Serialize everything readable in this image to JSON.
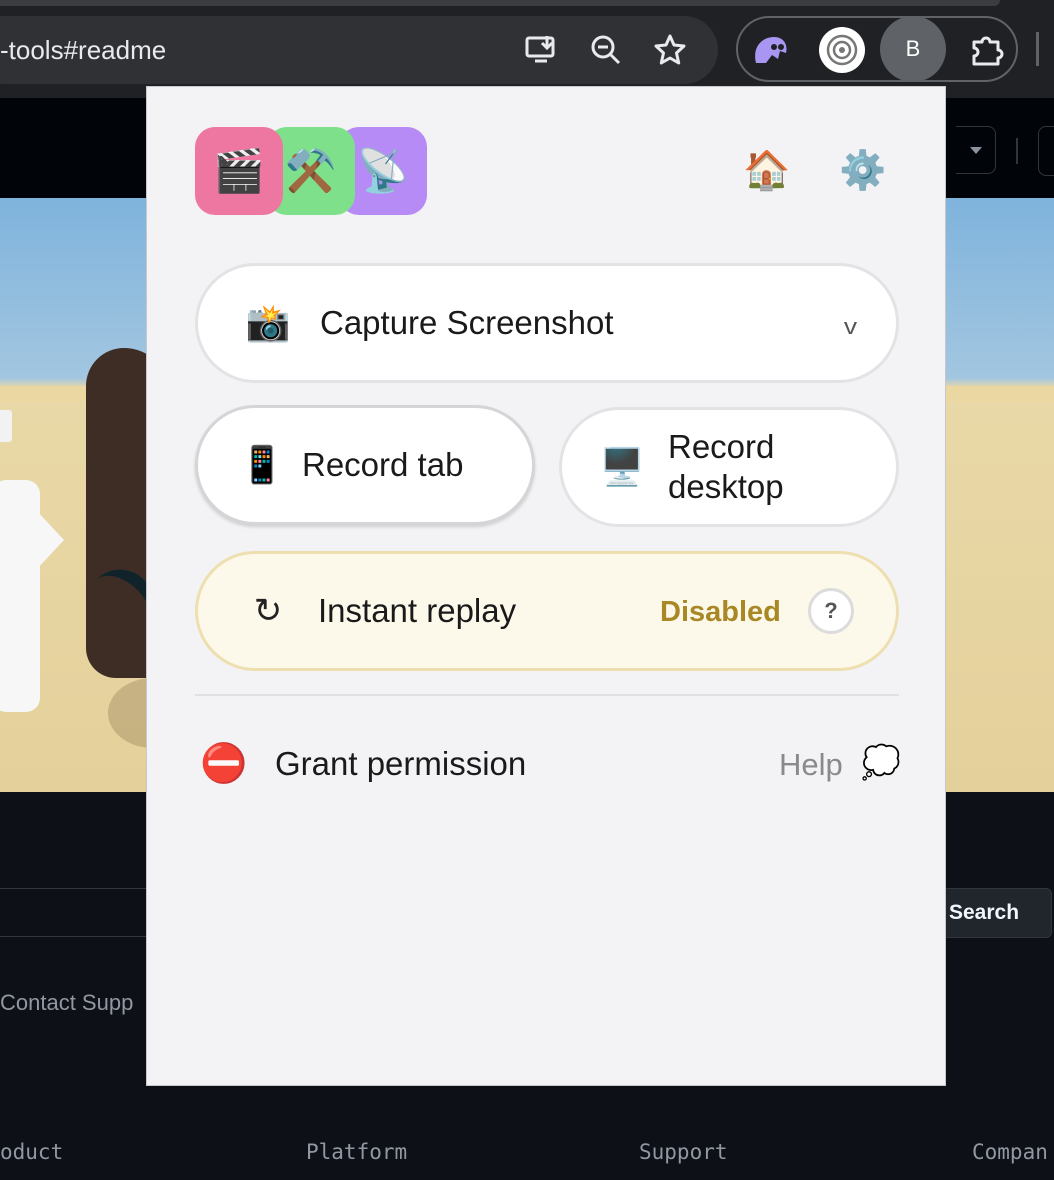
{
  "browser": {
    "url_fragment": "-tools#readme",
    "icons": [
      "install-app-icon",
      "zoom-out-icon",
      "bookmark-star-icon"
    ],
    "extensions": [
      "ghost-extension-icon",
      "screen-recorder-extension-icon",
      "extensions-puzzle-icon"
    ],
    "profile_initial": "B"
  },
  "page": {
    "search_button_label": "Search",
    "contact_link": "Contact Supp",
    "footer_links": [
      "oduct",
      "Platform",
      "Support",
      "Compan"
    ]
  },
  "popup": {
    "logo_tiles": [
      {
        "emoji": "🎬",
        "color": "#ee77a2"
      },
      {
        "emoji": "⚒️",
        "color": "#7ee08a"
      },
      {
        "emoji": "📡",
        "color": "#b68bf5"
      }
    ],
    "home_emoji": "🏠",
    "settings_emoji": "⚙️",
    "capture": {
      "emoji": "📸",
      "label": "Capture Screenshot",
      "chevron": "v"
    },
    "record_tab": {
      "emoji": "📱",
      "label": "Record tab"
    },
    "record_desktop": {
      "emoji": "🖥️",
      "label_line1": "Record",
      "label_line2": "desktop"
    },
    "instant_replay": {
      "icon": "↻",
      "label": "Instant replay",
      "status": "Disabled",
      "help": "?"
    },
    "permission": {
      "emoji": "⛔",
      "label": "Grant permission",
      "help_label": "Help",
      "help_emoji": "💭"
    }
  }
}
